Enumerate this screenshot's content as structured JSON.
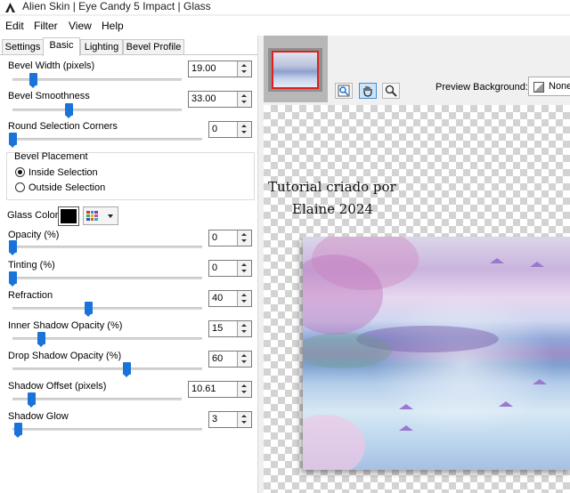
{
  "window": {
    "title": "Alien Skin | Eye Candy 5 Impact | Glass"
  },
  "menu": [
    "Edit",
    "Filter",
    "View",
    "Help"
  ],
  "tabs": [
    "Settings",
    "Basic",
    "Lighting",
    "Bevel Profile"
  ],
  "active_tab": "Basic",
  "controls": {
    "bevel_width": {
      "label": "Bevel Width (pixels)",
      "value": "19.00",
      "level": 0.12
    },
    "bevel_smoothness": {
      "label": "Bevel Smoothness",
      "value": "33.00",
      "level": 0.33
    },
    "round_corners": {
      "label": "Round Selection Corners",
      "value": "0",
      "level": 0.0
    },
    "opacity": {
      "label": "Opacity (%)",
      "value": "0",
      "level": 0.0
    },
    "tinting": {
      "label": "Tinting (%)",
      "value": "0",
      "level": 0.0
    },
    "refraction": {
      "label": "Refraction",
      "value": "40",
      "level": 0.4
    },
    "inner_shadow": {
      "label": "Inner Shadow Opacity (%)",
      "value": "15",
      "level": 0.15
    },
    "drop_shadow": {
      "label": "Drop Shadow Opacity (%)",
      "value": "60",
      "level": 0.6
    },
    "shadow_offset": {
      "label": "Shadow Offset (pixels)",
      "value": "10.61",
      "level": 0.11
    },
    "shadow_glow": {
      "label": "Shadow Glow",
      "value": "3",
      "level": 0.03
    }
  },
  "bevel_placement": {
    "legend": "Bevel Placement",
    "options": [
      "Inside Selection",
      "Outside Selection"
    ],
    "selected": "Inside Selection"
  },
  "glass_color": {
    "label": "Glass Color",
    "color": "#000000"
  },
  "preview": {
    "label": "Preview Background:",
    "value": "None"
  },
  "watermark": {
    "line1": "Tutorial criado por",
    "line2": "Elaine 2024"
  },
  "icons": [
    "app-icon",
    "zoom-icon",
    "hand-icon",
    "magnifier-icon",
    "color-grid-icon"
  ]
}
